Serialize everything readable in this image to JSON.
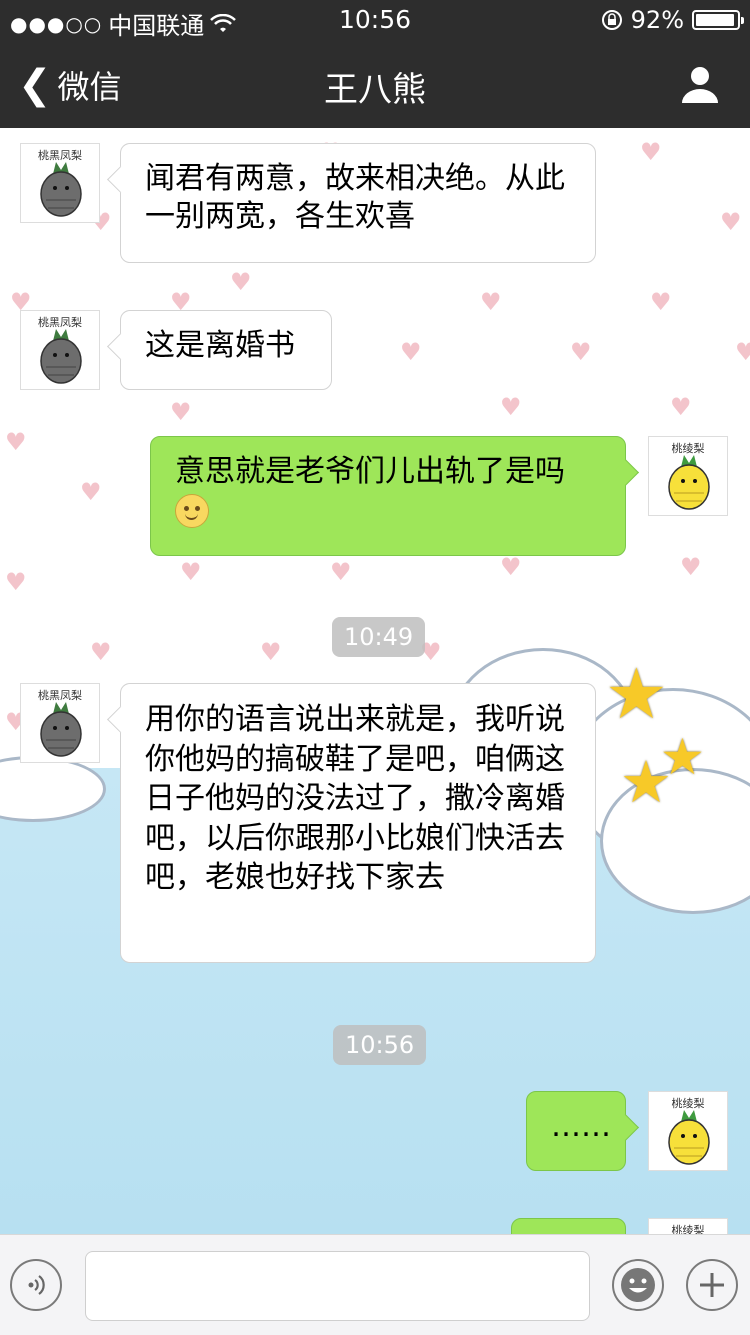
{
  "status_bar": {
    "signal": "●●●○○",
    "carrier": "中国联通",
    "time": "10:56",
    "battery": "92%"
  },
  "nav": {
    "back_label": "微信",
    "title": "王八熊"
  },
  "avatars": {
    "incoming_caption": "桃黑凤梨",
    "outgoing_caption": "桃绫梨"
  },
  "messages": [
    {
      "side": "in",
      "text": "闻君有两意，故来相决绝。从此一别两宽，各生欢喜"
    },
    {
      "side": "in",
      "text": "这是离婚书"
    },
    {
      "side": "out",
      "text": "意思就是老爷们儿出轨了是吗"
    },
    {
      "side": "time",
      "text": "10:49"
    },
    {
      "side": "in",
      "text": "用你的语言说出来就是，我听说你他妈的搞破鞋了是吧，咱俩这日子他妈的没法过了，撒冷离婚吧，以后你跟那小比娘们快活去吧，老娘也好找下家去"
    },
    {
      "side": "time",
      "text": "10:56"
    },
    {
      "side": "out",
      "text": "……"
    }
  ],
  "input": {
    "placeholder": ""
  }
}
